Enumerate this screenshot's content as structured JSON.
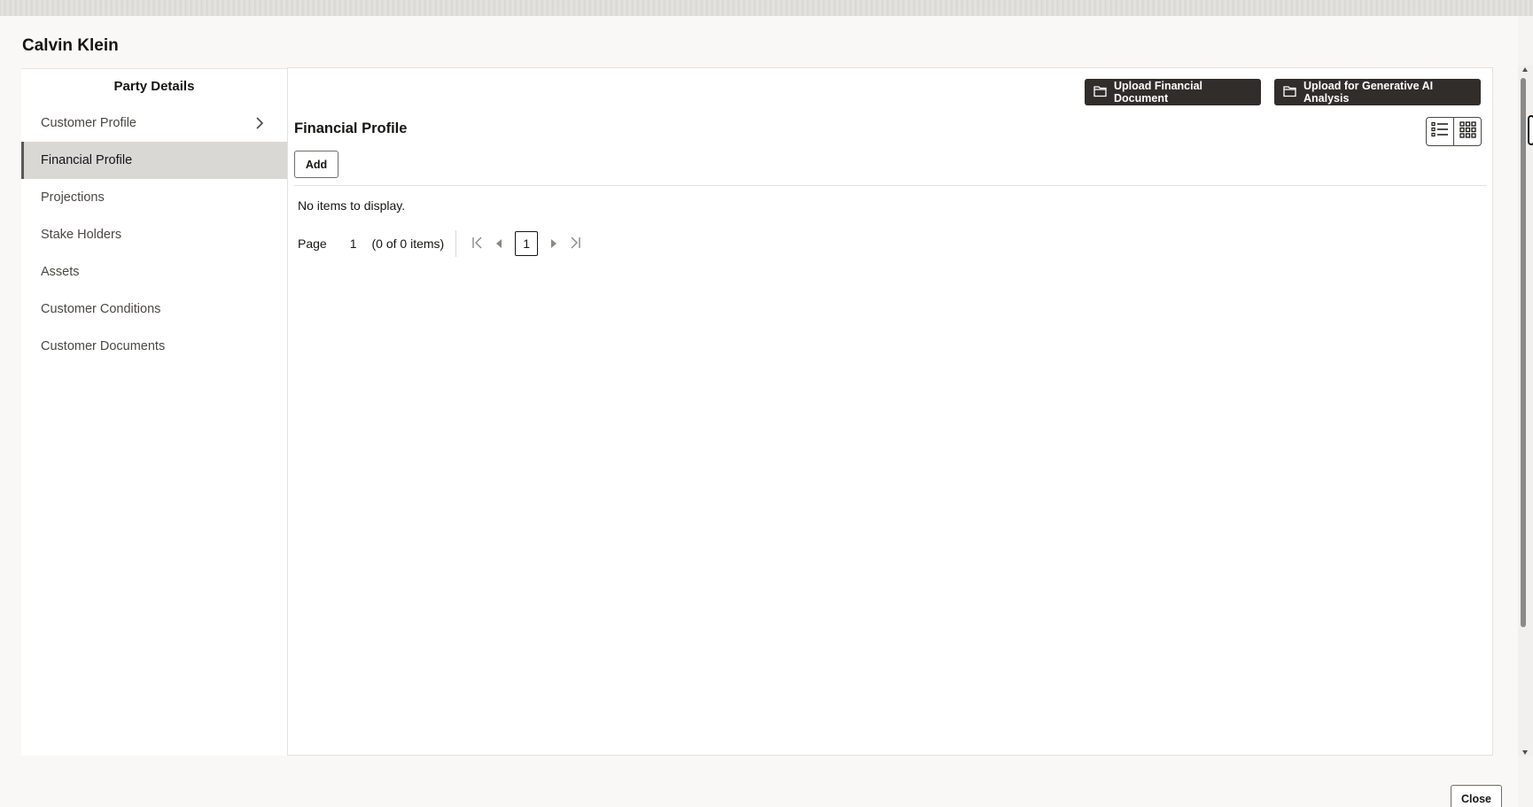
{
  "dialog": {
    "title": "Calvin Klein",
    "close_label": "Close"
  },
  "sidebar": {
    "heading": "Party Details",
    "items": [
      {
        "label": "Customer Profile",
        "has_chevron": true,
        "active": false
      },
      {
        "label": "Financial Profile",
        "active": true
      },
      {
        "label": "Projections",
        "active": false
      },
      {
        "label": "Stake Holders",
        "active": false
      },
      {
        "label": "Assets",
        "active": false
      },
      {
        "label": "Customer Conditions",
        "active": false
      },
      {
        "label": "Customer Documents",
        "active": false
      }
    ]
  },
  "main": {
    "upload_financial_label": "Upload Financial Document",
    "upload_ai_label": "Upload for Generative AI Analysis",
    "section_title": "Financial Profile",
    "add_label": "Add",
    "empty_message": "No items to display.",
    "view_modes": [
      "list-view-icon",
      "grid-view-icon"
    ]
  },
  "pagination": {
    "page_label": "Page",
    "page_value": "1",
    "items_summary": "(0 of 0 items)",
    "current_page": "1"
  },
  "colors": {
    "primary_button_bg": "#312d2a",
    "active_nav_bg": "#dad8d5",
    "page_bg": "#f9f8f6"
  }
}
